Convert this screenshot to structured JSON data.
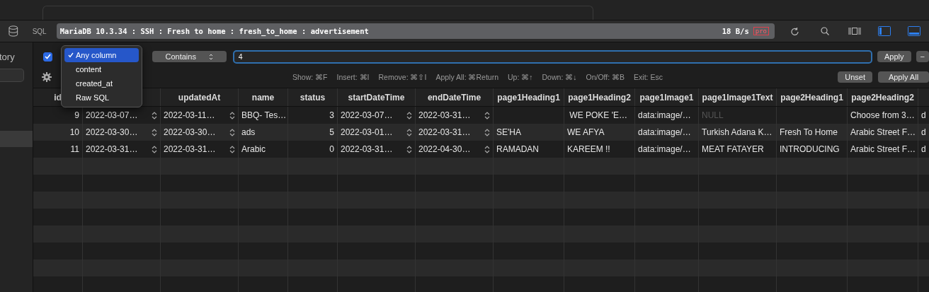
{
  "toolbar": {
    "sql_label": "SQL",
    "connection": "MariaDB 10.3.34 : SSH : Fresh to home : fresh_to_home : advertisement",
    "rate": "18 B/s",
    "badge": "pro",
    "sidebar_on": true,
    "bottom_panel_on": true
  },
  "sidebar": {
    "heading": "tory"
  },
  "filter": {
    "enabled": true,
    "column_menu": [
      {
        "label": "Any column",
        "selected": true
      },
      {
        "label": "content",
        "selected": false
      },
      {
        "label": "created_at",
        "selected": false
      },
      {
        "label": "Raw SQL",
        "selected": false
      }
    ],
    "operator": "Contains",
    "value": "4",
    "apply": "Apply",
    "remove": "−",
    "shortcuts": [
      "Show: ⌘F",
      "Insert: ⌘I",
      "Remove: ⌘⇧I",
      "Apply All: ⌘Return",
      "Up: ⌘↑",
      "Down: ⌘↓",
      "On/Off: ⌘B",
      "Exit: Esc"
    ],
    "unset": "Unset",
    "apply_all": "Apply All"
  },
  "table": {
    "columns": [
      {
        "label": "id",
        "kind": "number"
      },
      {
        "kind": "date"
      },
      {
        "label": "updatedAt",
        "kind": "date"
      },
      {
        "label": "name",
        "kind": "text"
      },
      {
        "label": "status",
        "kind": "number"
      },
      {
        "label": "startDateTime",
        "kind": "date"
      },
      {
        "label": "endDateTime",
        "kind": "date"
      },
      {
        "label": "page1Heading1",
        "kind": "text"
      },
      {
        "label": "page1Heading2",
        "kind": "text"
      },
      {
        "label": "page1Image1",
        "kind": "text"
      },
      {
        "label": "page1Image1Text",
        "kind": "text"
      },
      {
        "label": "page2Heading1",
        "kind": "text"
      },
      {
        "label": "page2Heading2",
        "kind": "text"
      },
      {
        "kind": "text"
      }
    ],
    "rows": [
      {
        "cells": [
          "9",
          "2022-03-07…",
          "2022-03-11…",
          "BBQ- Tes…",
          "3",
          "2022-03-07…",
          "2022-03-31…",
          "",
          " WE POKE 'E…",
          "data:image/…",
          {
            "text": "NULL",
            "null": true
          },
          "",
          "Choose from 3…",
          "d"
        ]
      },
      {
        "cells": [
          "10",
          "2022-03-30…",
          "2022-03-30…",
          "ads",
          "5",
          "2022-03-01…",
          "2022-03-31…",
          "SE'HA",
          "WE AFYA",
          "data:image/…",
          "Turkish Adana K…",
          "Fresh To Home",
          "Arabic Street F…",
          "d"
        ]
      },
      {
        "cells": [
          "11",
          "2022-03-31…",
          "2022-03-31…",
          "Arabic",
          "0",
          "2022-03-31…",
          "2022-04-30…",
          "RAMADAN",
          "KAREEM !!",
          "data:image/…",
          "MEAT FATAYER",
          "INTRODUCING",
          "Arabic Street F…",
          "d"
        ]
      }
    ]
  }
}
